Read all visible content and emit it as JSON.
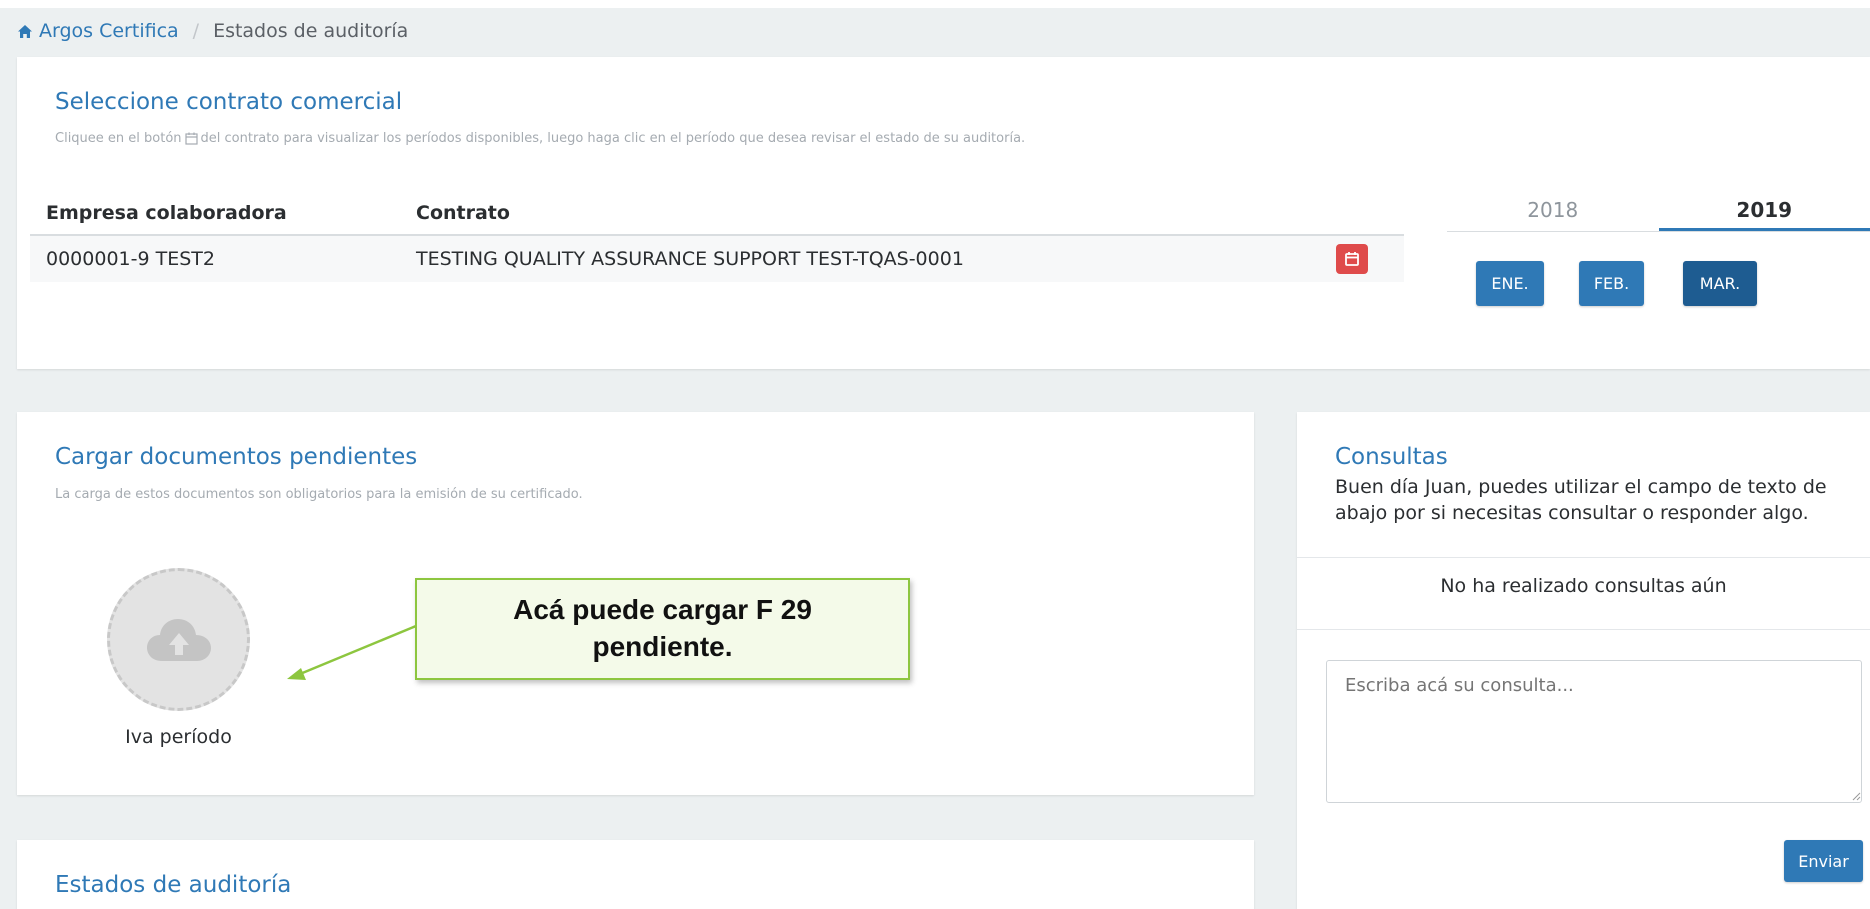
{
  "breadcrumb": {
    "home_label": "Argos Certifica",
    "current": "Estados de auditoría"
  },
  "contract_panel": {
    "title": "Seleccione contrato comercial",
    "hint_before": "Cliquee en el botón",
    "hint_after": "del contrato para visualizar los períodos disponibles, luego haga clic en el período que desea revisar el estado de su auditoría.",
    "columns": [
      "Empresa colaboradora",
      "Contrato"
    ],
    "rows": [
      {
        "empresa": "0000001-9 TEST2",
        "contrato": "TESTING QUALITY ASSURANCE SUPPORT TEST-TQAS-0001"
      }
    ],
    "years": [
      "2018",
      "2019"
    ],
    "active_year": "2019",
    "months": [
      "ENE.",
      "FEB.",
      "MAR."
    ],
    "selected_month": "MAR."
  },
  "pending_panel": {
    "title": "Cargar documentos pendientes",
    "hint": "La carga de estos documentos son obligatorios para la emisión de su certificado.",
    "document_label": "Iva período"
  },
  "callout": {
    "text": "Acá puede cargar F 29 pendiente."
  },
  "consultas_panel": {
    "title": "Consultas",
    "greeting": "Buen día Juan, puedes utilizar el campo de texto de abajo por si necesitas consultar o responder algo.",
    "empty_message": "No ha realizado consultas aún",
    "textarea_placeholder": "Escriba acá su consulta...",
    "send_label": "Enviar"
  },
  "audit_panel": {
    "title": "Estados de auditoría"
  },
  "colors": {
    "accent": "#2f79b6",
    "danger": "#df4b4b",
    "callout_border": "#8dc63f",
    "background": "#ecf0f1"
  },
  "icons": {
    "home": "home-icon",
    "calendar": "calendar-icon",
    "upload": "cloud-upload-icon"
  }
}
